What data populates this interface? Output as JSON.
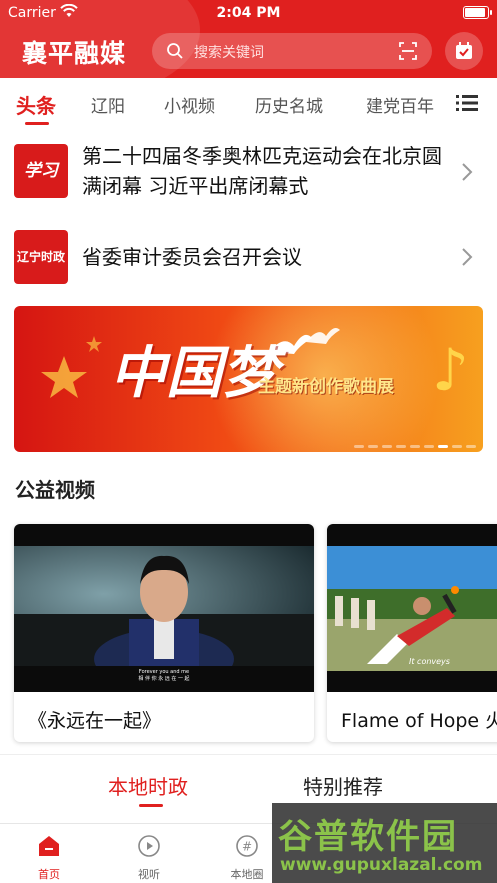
{
  "status_bar": {
    "carrier": "Carrier",
    "time": "2:04 PM",
    "battery_level": 1.0
  },
  "header": {
    "logo": "襄平融媒",
    "search_placeholder": "搜索关键词",
    "icons": [
      "search-icon",
      "scan-icon",
      "calendar-check-icon"
    ]
  },
  "tabs": {
    "items": [
      "头条",
      "辽阳",
      "小视频",
      "历史名城",
      "建党百年"
    ],
    "active": "头条"
  },
  "news": [
    {
      "thumb": "学习",
      "title": "第二十四届冬季奥林匹克运动会在北京圆满闭幕 习近平出席闭幕式"
    },
    {
      "thumb": "辽宁时政",
      "title": "省委审计委员会召开会议"
    }
  ],
  "banner": {
    "title": "中国梦",
    "subtitle": "主题新创作歌曲展",
    "slide_count": 9,
    "active_slide": 6
  },
  "section": {
    "title": "公益视频"
  },
  "videos": [
    {
      "title": "《永远在一起》",
      "caption_line1": "Forever you and me",
      "caption_line2": "相 伴 你 永 远 在 一 起"
    },
    {
      "title": "Flame of Hope 火",
      "caption": "It conveys"
    }
  ],
  "subtabs": {
    "items": [
      "本地时政",
      "特别推荐"
    ],
    "active": "本地时政"
  },
  "tabbar": {
    "items": [
      "首页",
      "视听",
      "本地圈"
    ],
    "active": "首页"
  },
  "watermark": {
    "line1": "谷普软件园",
    "line2": "www.gupuxlazal.com"
  },
  "colors": {
    "brand_red": "#e0201f"
  }
}
